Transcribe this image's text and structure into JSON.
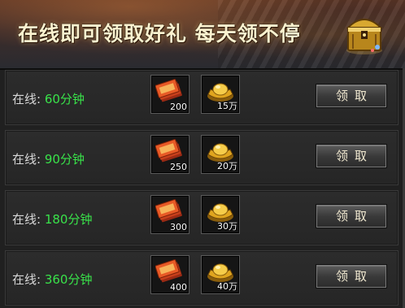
{
  "banner": {
    "title": "在线即可领取好礼 每天领不停"
  },
  "rows": [
    {
      "label": "在线: ",
      "time": "60分钟",
      "items": [
        {
          "icon": "red-ticket-icon",
          "qty": "200"
        },
        {
          "icon": "gold-ingot-icon",
          "qty": "15万"
        }
      ],
      "button": "领取"
    },
    {
      "label": "在线: ",
      "time": "90分钟",
      "items": [
        {
          "icon": "red-ticket-icon",
          "qty": "250"
        },
        {
          "icon": "gold-ingot-icon",
          "qty": "20万"
        }
      ],
      "button": "领取"
    },
    {
      "label": "在线: ",
      "time": "180分钟",
      "items": [
        {
          "icon": "red-ticket-icon",
          "qty": "300"
        },
        {
          "icon": "gold-ingot-icon",
          "qty": "30万"
        }
      ],
      "button": "领取"
    },
    {
      "label": "在线: ",
      "time": "360分钟",
      "items": [
        {
          "icon": "red-ticket-icon",
          "qty": "400"
        },
        {
          "icon": "gold-ingot-icon",
          "qty": "40万"
        }
      ],
      "button": "领取"
    }
  ],
  "colors": {
    "time_green": "#39e34a",
    "banner_text": "#fbf2cf"
  }
}
